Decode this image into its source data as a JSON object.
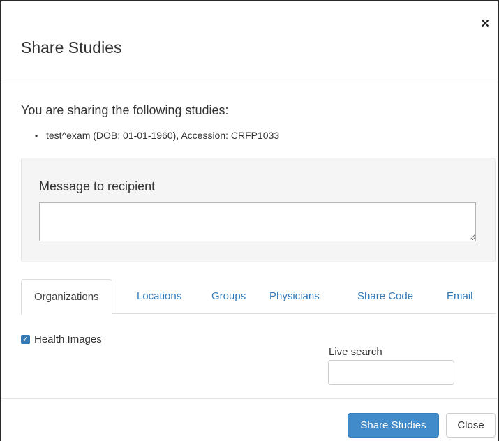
{
  "modal": {
    "title": "Share Studies",
    "close_symbol": "×"
  },
  "sharing": {
    "heading": "You are sharing the following studies:",
    "bullet": "•",
    "studies": [
      "test^exam (DOB: 01-01-1960), Accession: CRFP1033"
    ]
  },
  "message": {
    "label": "Message to recipient",
    "value": "",
    "placeholder": ""
  },
  "tabs": [
    {
      "label": "Organizations",
      "active": true
    },
    {
      "label": "Locations",
      "active": false
    },
    {
      "label": "Groups",
      "active": false
    },
    {
      "label": "Physicians",
      "active": false
    },
    {
      "label": "Share Code",
      "active": false
    },
    {
      "label": "Email",
      "active": false
    }
  ],
  "organizations": [
    {
      "label": "Health Images",
      "checked": true,
      "check_glyph": "✓"
    }
  ],
  "live_search": {
    "label": "Live search",
    "value": "",
    "placeholder": ""
  },
  "footer": {
    "share_label": "Share Studies",
    "close_label": "Close"
  },
  "colors": {
    "primary": "#428bca",
    "link": "#337ab7",
    "well": "#f5f5f5"
  }
}
